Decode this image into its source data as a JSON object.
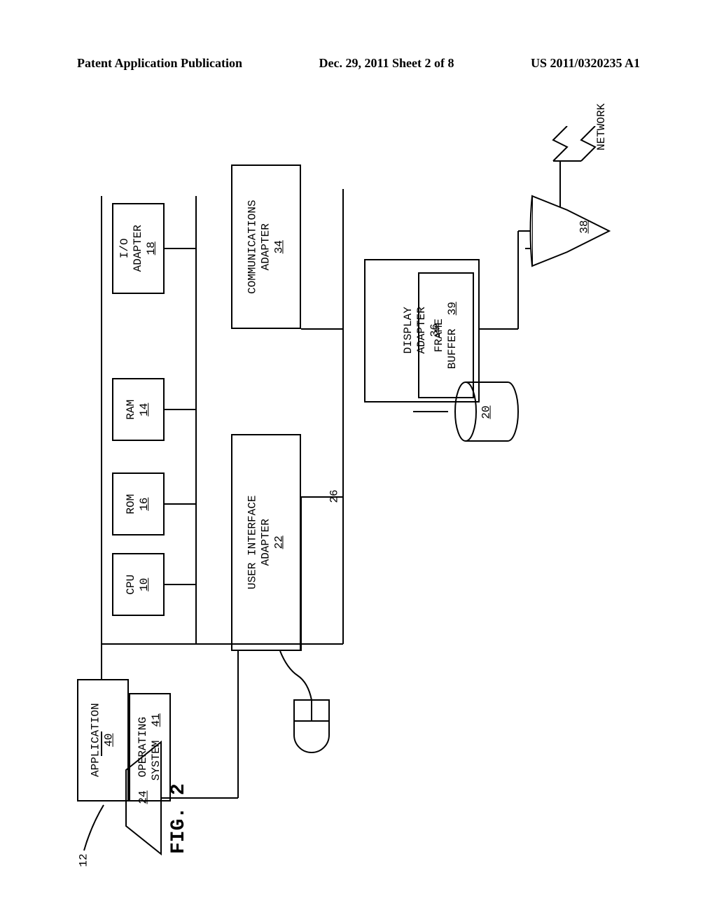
{
  "header": {
    "left": "Patent Application Publication",
    "center": "Dec. 29, 2011  Sheet 2 of 8",
    "right": "US 2011/0320235 A1"
  },
  "figure": {
    "label": "FIG. 2"
  },
  "blocks": {
    "application": {
      "label": "APPLICATION",
      "ref": "40"
    },
    "operating_system": {
      "label": "OPERATING",
      "label2": "SYSTEM",
      "ref": "41"
    },
    "cpu": {
      "label": "CPU",
      "ref": "10"
    },
    "rom": {
      "label": "ROM",
      "ref": "16"
    },
    "ram": {
      "label": "RAM",
      "ref": "14"
    },
    "io_adapter": {
      "label": "I/O",
      "label2": "ADAPTER",
      "ref": "18"
    },
    "comm_adapter": {
      "label": "COMMUNICATIONS",
      "label2": "ADAPTER",
      "ref": "34"
    },
    "user_interface": {
      "label": "USER INTERFACE",
      "label2": "ADAPTER",
      "ref": "22"
    },
    "display_adapter": {
      "label": "DISPLAY",
      "label2": "ADAPTER",
      "ref": "36"
    },
    "frame_buffer": {
      "label": "FRAME",
      "label2": "BUFFER",
      "ref": "39"
    },
    "network": {
      "label": "NETWORK"
    },
    "disk": {
      "ref": "20"
    },
    "monitor": {
      "ref": "38"
    },
    "keyboard": {
      "ref": "24"
    },
    "mouse": {
      "ref": "26"
    },
    "bus": {
      "ref": "12"
    }
  }
}
